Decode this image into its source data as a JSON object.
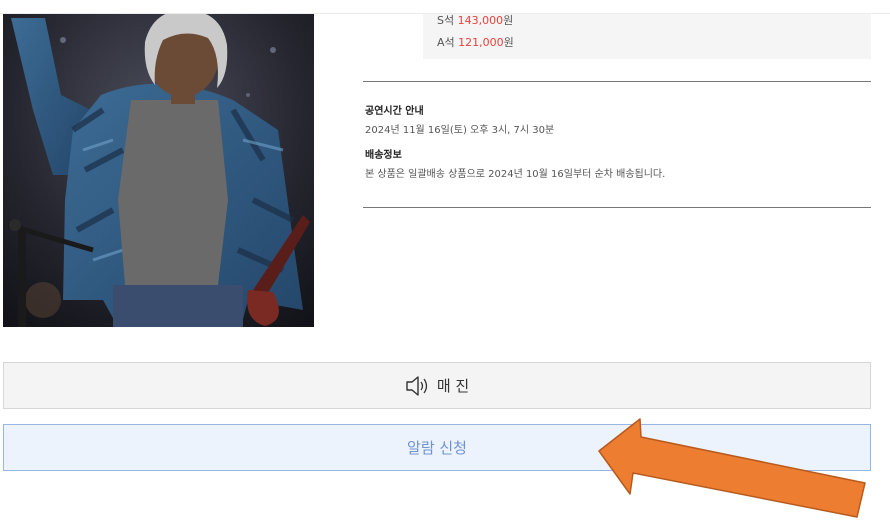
{
  "price": {
    "s_label": "S석",
    "s_amount": "143,000",
    "s_unit": "원",
    "a_label": "A석",
    "a_amount": "121,000",
    "a_unit": "원"
  },
  "info": {
    "schedule_title": "공연시간 안내",
    "schedule_text": "2024년 11월 16일(토) 오후 3시, 7시 30분",
    "delivery_title": "배송정보",
    "delivery_text": "본 상품은 일괄배송 상품으로 2024년 10월 16일부터 순차 배송됩니다."
  },
  "buttons": {
    "soldout_label": "매 진",
    "alarm_label": "알람 신청"
  },
  "icons": {
    "soldout": "speaker-icon",
    "poster": "concert-poster-image",
    "annotation": "arrow-annotation"
  },
  "colors": {
    "price_accent": "#e8413c",
    "alarm_text": "#6f93cf",
    "alarm_border": "#98b6e4",
    "arrow_fill": "#ed7d31"
  }
}
